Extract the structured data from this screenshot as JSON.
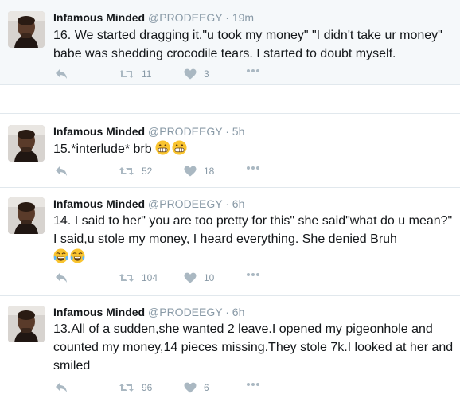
{
  "tweets": [
    {
      "name": "Infamous Minded",
      "handle": "@PRODEEGY",
      "dot": "·",
      "time": "19m",
      "text": "16. We started dragging it.\"u took my money\" \"I didn't take ur money\" babe was shedding crocodile tears. I started to doubt myself.",
      "retweets": "11",
      "likes": "3"
    },
    {
      "name": "Infamous Minded",
      "handle": "@PRODEEGY",
      "dot": "·",
      "time": "5h",
      "text": "15.*interlude* brb",
      "emojis": [
        "grimacing",
        "grimacing"
      ],
      "retweets": "52",
      "likes": "18"
    },
    {
      "name": "Infamous Minded",
      "handle": "@PRODEEGY",
      "dot": "·",
      "time": "6h",
      "text": "14. I said to her\" you are too pretty for this\" she said\"what do u mean?\" I said,u stole my money, I heard everything. She denied Bruh",
      "emojis": [
        "tears-of-joy",
        "tears-of-joy"
      ],
      "retweets": "104",
      "likes": "10"
    },
    {
      "name": "Infamous Minded",
      "handle": "@PRODEEGY",
      "dot": "·",
      "time": "6h",
      "text": "13.All of a sudden,she wanted 2 leave.I opened my pigeonhole and counted my money,14 pieces missing.They stole 7k.I looked at her and smiled",
      "retweets": "96",
      "likes": "6"
    }
  ],
  "colors": {
    "text": "#14171a",
    "muted": "#8899a6",
    "icon": "#aab8c2",
    "divider": "#e1e8ed",
    "highlight_bg": "#f5f8fa"
  },
  "icons": {
    "reply": "reply-icon",
    "retweet": "retweet-icon",
    "like": "heart-icon",
    "more": "more-icon"
  }
}
